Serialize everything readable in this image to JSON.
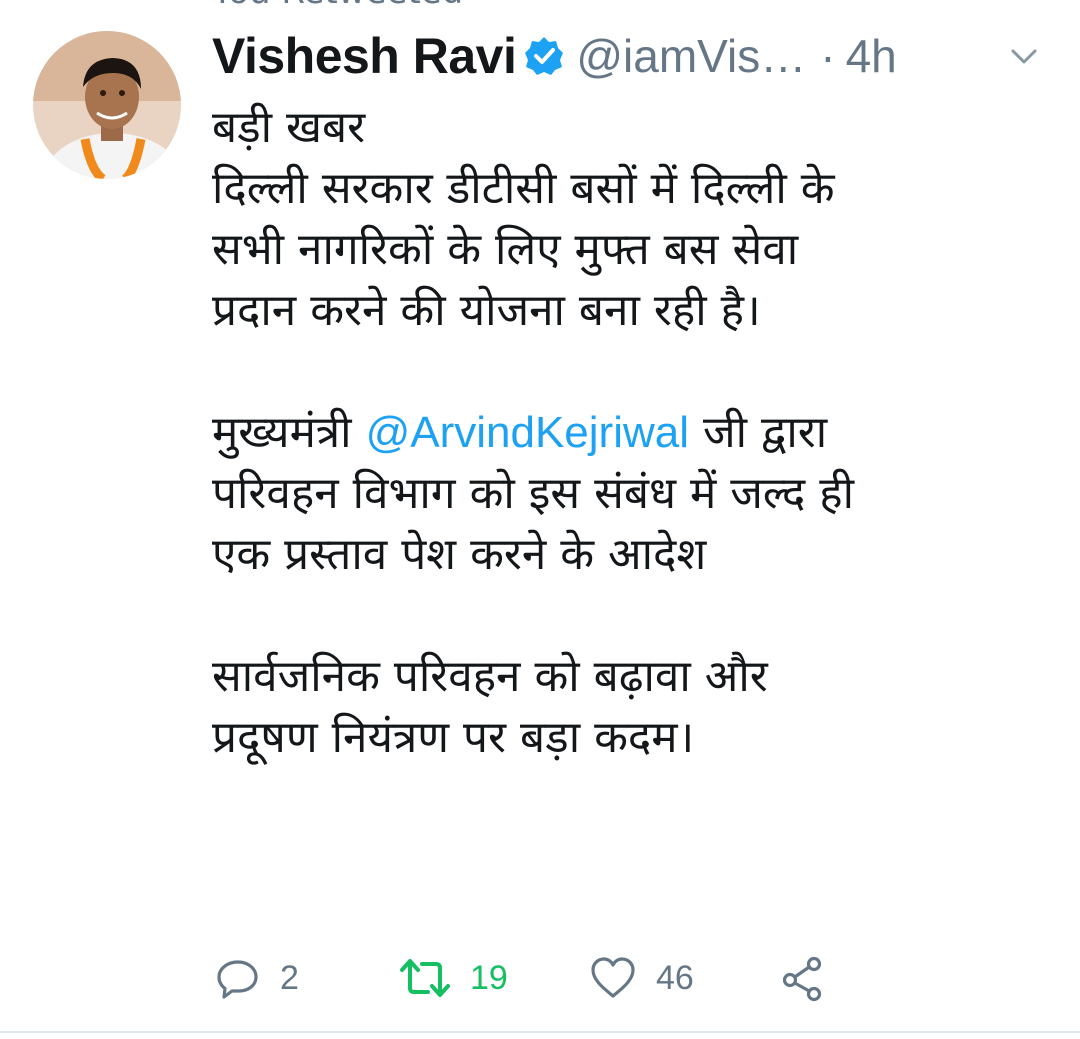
{
  "context": {
    "retweeted_label": "You Retweeted"
  },
  "tweet": {
    "author_name": "Vishesh Ravi",
    "handle": "@iamVis…",
    "separator": "·",
    "time": "4h",
    "lines": [
      {
        "text": "बड़ी खबर"
      },
      {
        "text": "दिल्ली सरकार डीटीसी बसों में दिल्ली के"
      },
      {
        "text": "सभी नागरिकों के लिए मुफ्त बस सेवा"
      },
      {
        "text": "प्रदान करने की योजना बना रही है।"
      },
      {
        "text": ""
      },
      {
        "before": "मुख्यमंत्री ",
        "mention": "@ArvindKejriwal",
        "after": " जी द्वारा"
      },
      {
        "text": "परिवहन विभाग को इस संबंध में जल्द ही"
      },
      {
        "text": "एक प्रस्ताव पेश करने के आदेश"
      },
      {
        "text": ""
      },
      {
        "text": "सार्वजनिक परिवहन को बढ़ावा और"
      },
      {
        "text": "प्रदूषण नियंत्रण पर बड़ा कदम।"
      }
    ]
  },
  "actions": {
    "reply_count": "2",
    "retweet_count": "19",
    "like_count": "46"
  },
  "icons": {
    "verified": "verified-badge-icon",
    "caret": "chevron-down-icon",
    "reply": "reply-bubble-icon",
    "retweet": "retweet-arrows-icon",
    "like": "heart-icon",
    "share": "share-nodes-icon"
  },
  "colors": {
    "text": "#14171a",
    "secondary": "#657786",
    "link": "#1da1f2",
    "retweet_active": "#17bf63",
    "divider": "#e1e8ed"
  }
}
